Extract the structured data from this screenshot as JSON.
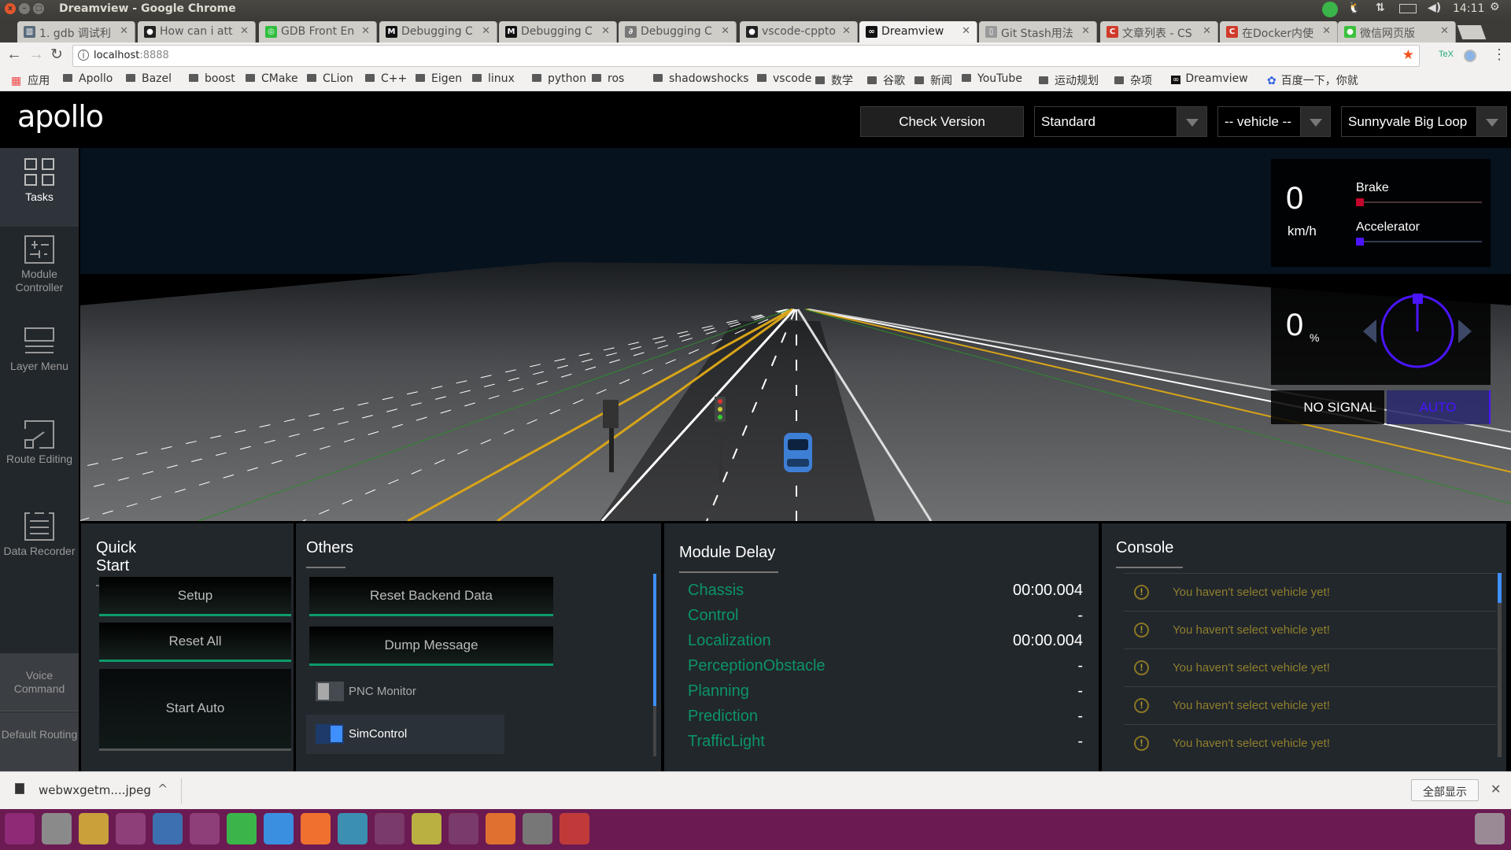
{
  "window": {
    "title": "Dreamview - Google Chrome",
    "clock": "14:11"
  },
  "tabs": [
    {
      "label": "1. gdb 调试利",
      "fav": "▥",
      "color": "#5a6b7b"
    },
    {
      "label": "How can i att",
      "fav": "●",
      "color": "#222"
    },
    {
      "label": "GDB Front En",
      "fav": "◎",
      "color": "#2fbf3f"
    },
    {
      "label": "Debugging C",
      "fav": "M",
      "color": "#111"
    },
    {
      "label": "Debugging C",
      "fav": "M",
      "color": "#111"
    },
    {
      "label": "Debugging C",
      "fav": "∂",
      "color": "#777"
    },
    {
      "label": "vscode-cppto",
      "fav": "●",
      "color": "#222"
    },
    {
      "label": "Dreamview",
      "fav": "∞",
      "color": "#111",
      "active": true
    },
    {
      "label": "Git Stash用法",
      "fav": "▯",
      "color": "#999"
    },
    {
      "label": "文章列表 - CS",
      "fav": "C",
      "color": "#d03a2a"
    },
    {
      "label": "在Docker内使",
      "fav": "C",
      "color": "#d03a2a"
    },
    {
      "label": "微信网页版",
      "fav": "●",
      "color": "#3cc13c"
    }
  ],
  "address": {
    "host": "localhost",
    "port": ":8888"
  },
  "bookmarks": [
    "应用",
    "Apollo",
    "Bazel",
    "boost",
    "CMake",
    "CLion",
    "C++",
    "Eigen",
    "linux",
    "python",
    "ros",
    "shadowshocks",
    "vscode",
    "数学",
    "谷歌",
    "新闻",
    "YouTube",
    "运动规划",
    "杂项",
    "Dreamview",
    "百度一下，你就"
  ],
  "header": {
    "logo": "apollo",
    "check_version": "Check Version",
    "mode": "Standard",
    "vehicle": "-- vehicle --",
    "map": "Sunnyvale Big Loop"
  },
  "sidebar": {
    "items": [
      {
        "label": "Tasks",
        "icon": "tasks-icon"
      },
      {
        "label": "Module Controller",
        "icon": "module-controller-icon"
      },
      {
        "label": "Layer Menu",
        "icon": "layer-menu-icon"
      },
      {
        "label": "Route Editing",
        "icon": "route-editing-icon"
      },
      {
        "label": "Data Recorder",
        "icon": "data-recorder-icon"
      }
    ],
    "bottom": [
      "Voice Command",
      "Default Routing"
    ]
  },
  "dashboard": {
    "speed": "0",
    "speed_unit": "km/h",
    "brake_label": "Brake",
    "brake_percent": 0,
    "accel_label": "Accelerator",
    "accel_percent": 0,
    "steering": "0",
    "steering_unit": "%",
    "signal": "NO SIGNAL",
    "drive_mode": "AUTO",
    "colors": {
      "brake": "#c4062c",
      "accel": "#4a14ff",
      "wheel": "#4a14ff"
    }
  },
  "quick_start": {
    "title": "Quick Start",
    "buttons": [
      "Setup",
      "Reset All",
      "Start Auto"
    ]
  },
  "others": {
    "title": "Others",
    "buttons": [
      "Reset Backend Data",
      "Dump Message"
    ],
    "toggles": [
      {
        "label": "PNC Monitor",
        "on": false
      },
      {
        "label": "SimControl",
        "on": true
      }
    ]
  },
  "module_delay": {
    "title": "Module Delay",
    "rows": [
      {
        "name": "Chassis",
        "value": "00:00.004"
      },
      {
        "name": "Control",
        "value": "-"
      },
      {
        "name": "Localization",
        "value": "00:00.004"
      },
      {
        "name": "PerceptionObstacle",
        "value": "-"
      },
      {
        "name": "Planning",
        "value": "-"
      },
      {
        "name": "Prediction",
        "value": "-"
      },
      {
        "name": "TrafficLight",
        "value": "-"
      }
    ]
  },
  "console": {
    "title": "Console",
    "messages": [
      "You haven't select vehicle yet!",
      "You haven't select vehicle yet!",
      "You haven't select vehicle yet!",
      "You haven't select vehicle yet!",
      "You haven't select vehicle yet!"
    ]
  },
  "download": {
    "file": "webwxgetm....jpeg",
    "show_all": "全部显示"
  }
}
